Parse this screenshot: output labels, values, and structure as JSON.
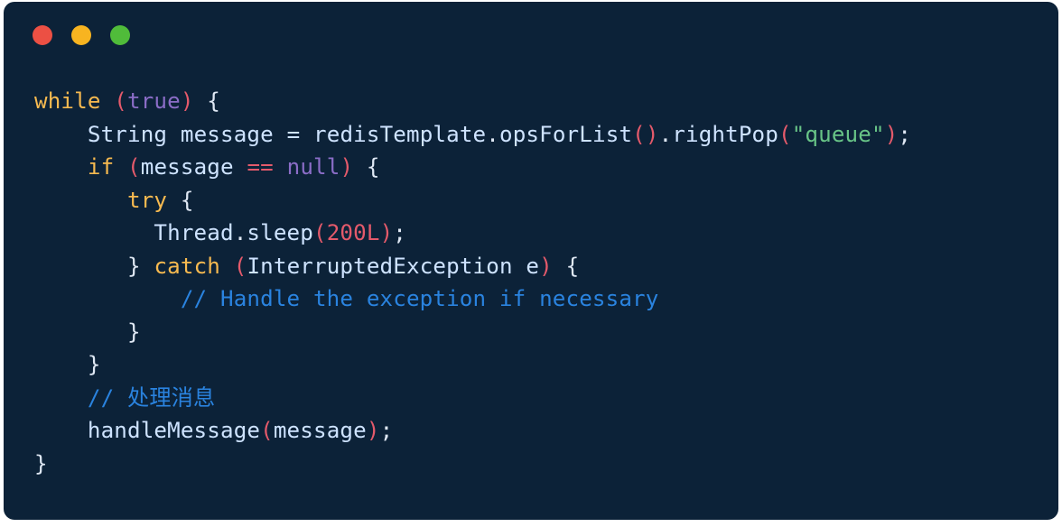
{
  "code": {
    "tokens": {
      "while": "while",
      "true": "true",
      "string_type": "String",
      "message_var": "message",
      "equals": "=",
      "redisTemplate": "redisTemplate",
      "opsForList": "opsForList",
      "rightPop": "rightPop",
      "queue_str": "\"queue\"",
      "if": "if",
      "eqeq": "==",
      "null": "null",
      "try": "try",
      "thread": "Thread",
      "sleep": "sleep",
      "sleep_arg": "200L",
      "catch": "catch",
      "interrupted_exception": "InterruptedException",
      "exc_var": "e",
      "comment_exc": "// Handle the exception if necessary",
      "comment_handle": "// 处理消息",
      "handleMessage": "handleMessage"
    }
  }
}
